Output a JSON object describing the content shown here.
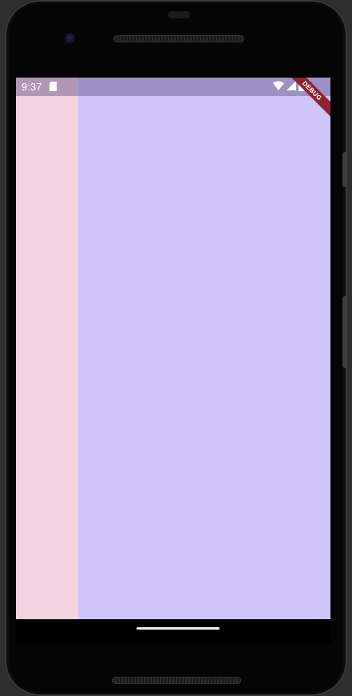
{
  "device": {
    "model_icon": "android-phone-frame"
  },
  "status_bar": {
    "time": "9:37",
    "icons": [
      "sd-card-icon",
      "wifi-icon",
      "cell-signal-icon",
      "battery-icon"
    ]
  },
  "debug_banner": {
    "label": "DEBUG",
    "color": "#8e2431"
  },
  "app": {
    "drawer_color": "#f4d2df",
    "content_color": "#d0c5f9"
  },
  "nav_bar": {
    "home_indicator": "home-gesture-pill"
  }
}
